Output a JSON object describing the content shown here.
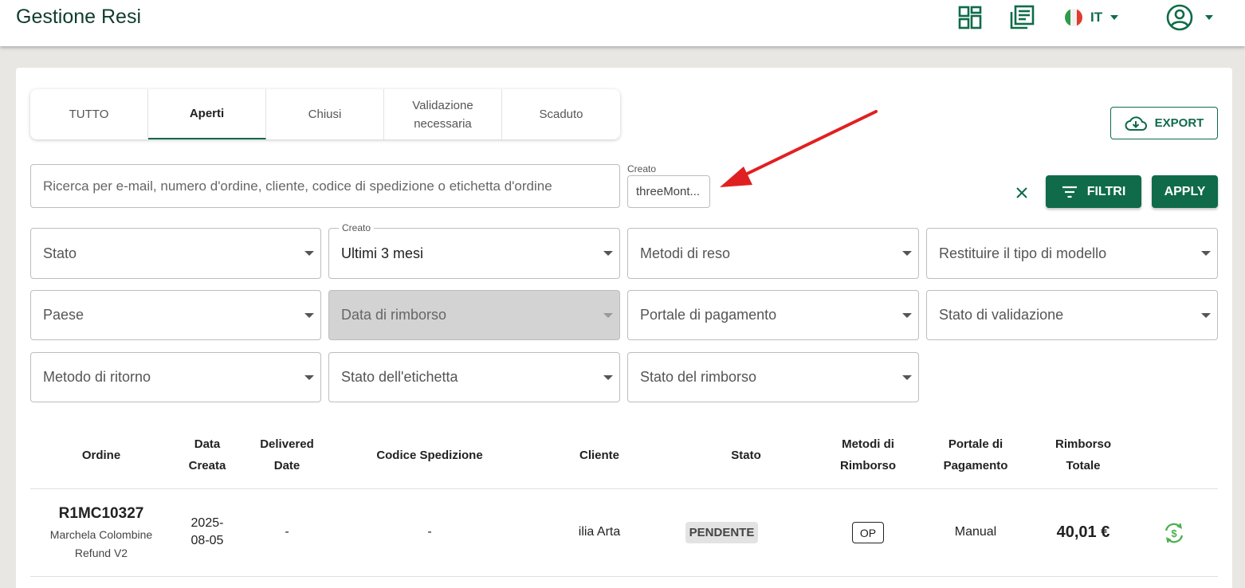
{
  "header": {
    "title": "Gestione Resi",
    "icons": [
      "dashboard-icon",
      "articles-icon",
      "italy-flag-icon",
      "account-icon"
    ],
    "language": "IT"
  },
  "tabs": [
    {
      "label": "TUTTO",
      "active": false
    },
    {
      "label": "Aperti",
      "active": true
    },
    {
      "label": "Chiusi",
      "active": false
    },
    {
      "label": "Validazione necessaria",
      "active": false
    },
    {
      "label": "Scaduto",
      "active": false
    }
  ],
  "export_label": "EXPORT",
  "search": {
    "placeholder": "Ricerca per e-mail, numero d'ordine, cliente, codice di spedizione o etichetta d'ordine",
    "value": ""
  },
  "created_chip": {
    "label": "Creato",
    "value": "threeMont..."
  },
  "filters_label": "FILTRI",
  "apply_label": "APPLY",
  "filters": {
    "stato": "Stato",
    "creato_label": "Creato",
    "creato_value": "Ultimi 3 mesi",
    "metodi_reso": "Metodi di reso",
    "tipo_modello": "Restituire il tipo di modello",
    "paese": "Paese",
    "data_rimborso": "Data di rimborso",
    "portale": "Portale di pagamento",
    "stato_validazione": "Stato di validazione",
    "metodo_ritorno": "Metodo di ritorno",
    "stato_etichetta": "Stato dell'etichetta",
    "stato_rimborso": "Stato del rimborso"
  },
  "table": {
    "columns": {
      "ordine": "Ordine",
      "data_creata_1": "Data",
      "data_creata_2": "Creata",
      "delivered_1": "Delivered",
      "delivered_2": "Date",
      "codice": "Codice Spedizione",
      "cliente": "Cliente",
      "stato": "Stato",
      "metodi_1": "Metodi di",
      "metodi_2": "Rimborso",
      "portale_1": "Portale di",
      "portale_2": "Pagamento",
      "rimborso_1": "Rimborso",
      "rimborso_2": "Totale"
    },
    "rows": [
      {
        "order_id": "R1MC10327",
        "store_1": "Marchela Colombine",
        "store_2": "Refund V2",
        "created_1": "2025-",
        "created_2": "08-05",
        "delivered": "-",
        "tracking": "-",
        "customer": "ilia Arta",
        "status": "PENDENTE",
        "refund_method": "OP",
        "payment_portal": "Manual",
        "total": "40,01 €",
        "action_icon": "refund-exchange-icon"
      }
    ]
  },
  "colors": {
    "brand_green": "#0f6b4a",
    "title_dark": "#0f3d2e",
    "arrow_red": "#e02020",
    "refund_icon_green": "#4caf50"
  }
}
